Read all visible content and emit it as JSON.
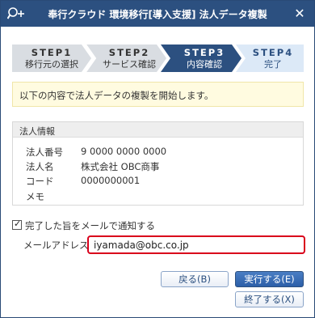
{
  "window": {
    "title": "奉行クラウド 環境移行[導入支援] 法人データ複製",
    "icons": {
      "app": "search-plus-icon",
      "close": "close-icon"
    }
  },
  "steps": [
    {
      "step": "STEP1",
      "label": "移行元の選択",
      "state": "done"
    },
    {
      "step": "STEP2",
      "label": "サービス確認",
      "state": "done"
    },
    {
      "step": "STEP3",
      "label": "内容確認",
      "state": "active"
    },
    {
      "step": "STEP4",
      "label": "完了",
      "state": "todo"
    }
  ],
  "notice": "以下の内容で法人データの複製を開始します。",
  "corp_info": {
    "heading": "法人情報",
    "rows": [
      {
        "key": "法人番号",
        "value": "9 0000 0000 0000"
      },
      {
        "key": "法人名",
        "value": "株式会社 OBC商事"
      },
      {
        "key": "コード",
        "value": "0000000001"
      },
      {
        "key": "メモ",
        "value": ""
      }
    ]
  },
  "notify": {
    "label": "完了した旨をメールで通知する",
    "checked": true
  },
  "email": {
    "label": "メールアドレス",
    "value": "iyamada@obc.co.jp"
  },
  "buttons": {
    "back": "戻る(B)",
    "run": "実行する(E)",
    "exit": "終了する(X)"
  },
  "colors": {
    "titlebar": "#2c5080",
    "step_done": "#d9dde2",
    "step_active": "#2c5080",
    "step_todo": "#dce9f7",
    "highlight_border": "#d9001b",
    "notice_bg": "#fffbe0"
  }
}
